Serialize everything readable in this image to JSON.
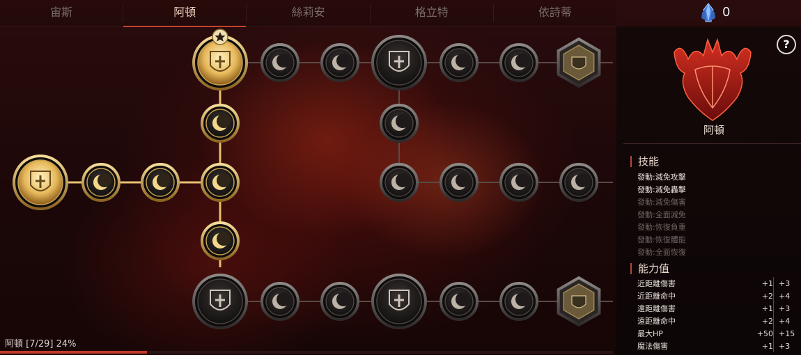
{
  "tabs": [
    "宙斯",
    "阿頓",
    "絲莉安",
    "格立特",
    "依詩蒂"
  ],
  "active_tab": 1,
  "crystal_count": "0",
  "help_label": "?",
  "hero_name": "阿頓",
  "skills_title": "技能",
  "skills": [
    {
      "label": "發動:減免攻擊",
      "active": true
    },
    {
      "label": "發動:減免轟擊",
      "active": true
    },
    {
      "label": "發動:減免傷害",
      "active": false
    },
    {
      "label": "發動:全面減免",
      "active": false
    },
    {
      "label": "發動:恢復負重",
      "active": false
    },
    {
      "label": "發動:恢復體能",
      "active": false
    },
    {
      "label": "發動:全面恢復",
      "active": false
    }
  ],
  "stats_title": "能力值",
  "stats": [
    {
      "label": "近距離傷害",
      "current": "+1",
      "max": "+3"
    },
    {
      "label": "近距離命中",
      "current": "+2",
      "max": "+4"
    },
    {
      "label": "遠距離傷害",
      "current": "+1",
      "max": "+3"
    },
    {
      "label": "遠距離命中",
      "current": "+2",
      "max": "+4"
    },
    {
      "label": "最大HP",
      "current": "+50",
      "max": "+15"
    },
    {
      "label": "魔法傷害",
      "current": "+1",
      "max": "+3"
    }
  ],
  "progress": {
    "label": "阿頓 [7/29] 24%",
    "percent": 24
  },
  "colors": {
    "accent": "#c43a2a",
    "gold": "#e8c878",
    "active_skill": "#e8e0da",
    "inactive_skill": "#6e6361"
  }
}
